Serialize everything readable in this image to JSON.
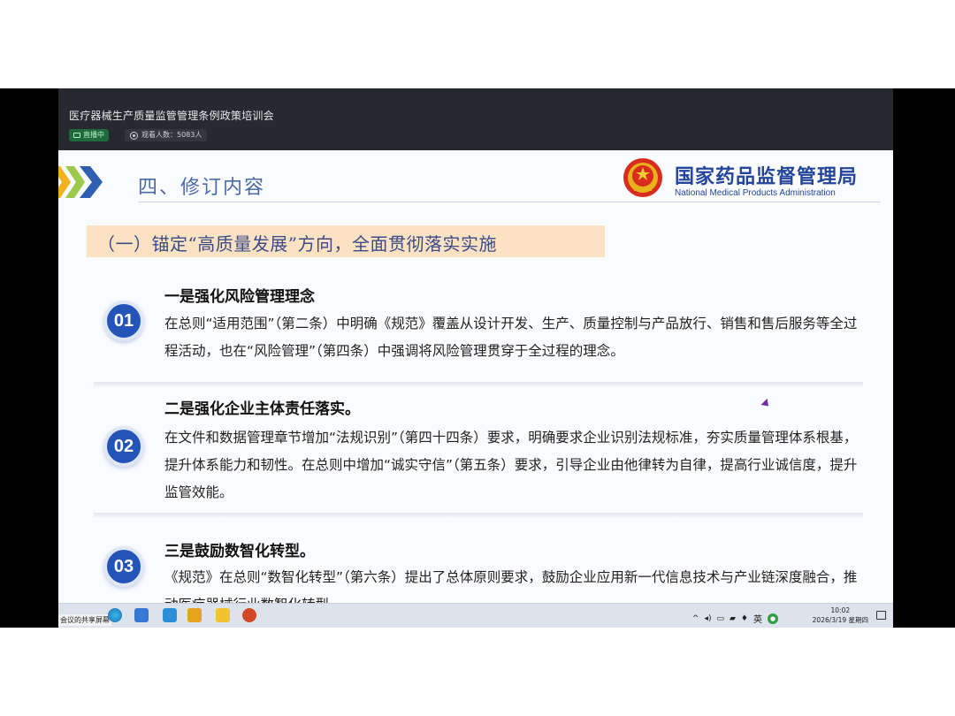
{
  "meeting": {
    "title": "医疗器械生产质量监管管理条例政策培训会",
    "live_label": "直播中",
    "viewers_label": "观看人数：5083人"
  },
  "slide": {
    "section_title": "四、修订内容",
    "org_name_cn": "国家药品监督管理局",
    "org_name_en": "National Medical Products Administration",
    "subtitle": "（一）锚定“高质量发展”方向，全面贯彻落实实施",
    "items": [
      {
        "number": "01",
        "title": "一是强化风险管理理念",
        "body": "在总则“适用范围”（第二条）中明确《规范》覆盖从设计开发、生产、质量控制与产品放行、销售和售后服务等全过程活动，也在“风险管理”（第四条）中强调将风险管理贯穿于全过程的理念。"
      },
      {
        "number": "02",
        "title": "二是强化企业主体责任落实。",
        "body": "在文件和数据管理章节增加“法规识别”（第四十四条）要求，明确要求企业识别法规标准，夯实质量管理体系根基，提升体系能力和韧性。在总则中增加“诚实守信”（第五条）要求，引导企业由他律转为自律，提高行业诚信度，提升监管效能。"
      },
      {
        "number": "03",
        "title": "三是鼓励数智化转型。",
        "body": "《规范》在总则“数智化转型”（第六条）提出了总体原则要求，鼓励企业应用新一代信息技术与产业链深度融合，推动医疗器械行业数智化转型。"
      }
    ]
  },
  "taskbar": {
    "share_label": "会议的共享屏幕",
    "ime_label": "英",
    "time": "10:02",
    "date": "2026/3/19 星期四"
  },
  "colors": {
    "brand_blue": "#23459a",
    "badge_blue": "#2454b8",
    "banner_bg": "#fbe2c3",
    "live_green": "#1e6a3b"
  }
}
